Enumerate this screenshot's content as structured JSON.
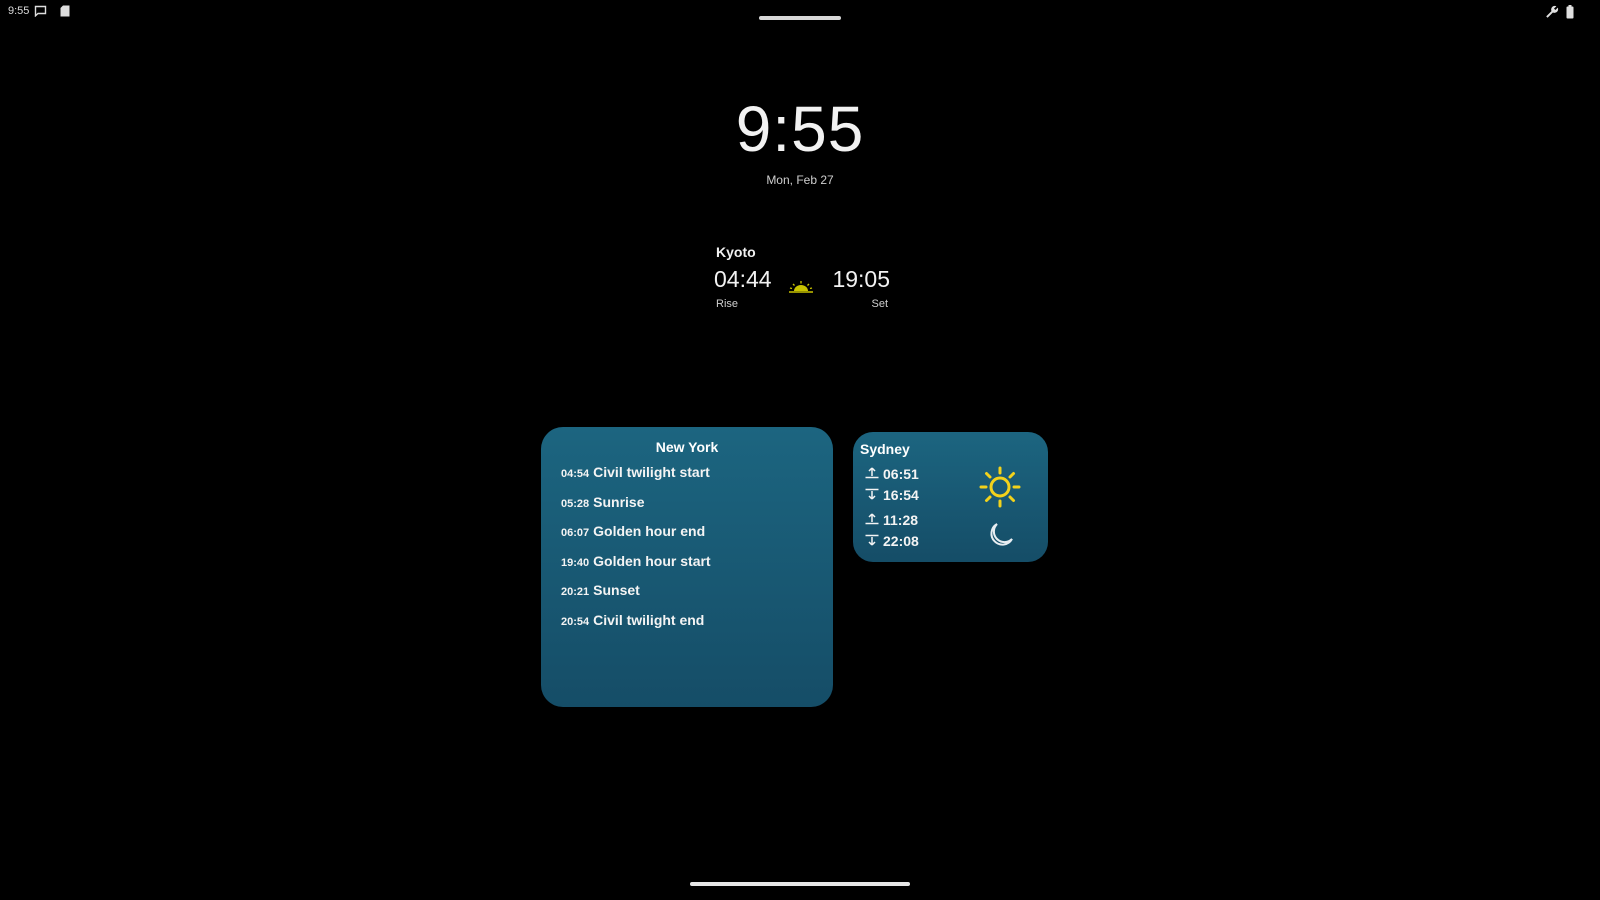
{
  "status_bar": {
    "time": "9:55",
    "icons_left": [
      "message-icon",
      "sd-card-icon"
    ],
    "icons_right": [
      "wrench-icon",
      "battery-icon"
    ]
  },
  "lock_screen": {
    "clock": "9:55",
    "date": "Mon, Feb 27"
  },
  "kyoto_widget": {
    "city": "Kyoto",
    "rise_time": "04:44",
    "rise_label": "Rise",
    "set_time": "19:05",
    "set_label": "Set",
    "icon": "sun-horizon-icon",
    "icon_color": "#c8c300"
  },
  "new_york_widget": {
    "city": "New York",
    "events": [
      {
        "time": "04:54",
        "label": "Civil twilight start"
      },
      {
        "time": "05:28",
        "label": "Sunrise"
      },
      {
        "time": "06:07",
        "label": "Golden hour end"
      },
      {
        "time": "19:40",
        "label": "Golden hour start"
      },
      {
        "time": "20:21",
        "label": "Sunset"
      },
      {
        "time": "20:54",
        "label": "Civil twilight end"
      }
    ],
    "background_color": "#1c6580"
  },
  "sydney_widget": {
    "city": "Sydney",
    "sun_rise": "06:51",
    "sun_set": "16:54",
    "moon_rise": "11:28",
    "moon_set": "22:08",
    "sun_icon": "sun-icon",
    "sun_icon_color": "#f2d21b",
    "moon_icon": "moon-icon"
  }
}
